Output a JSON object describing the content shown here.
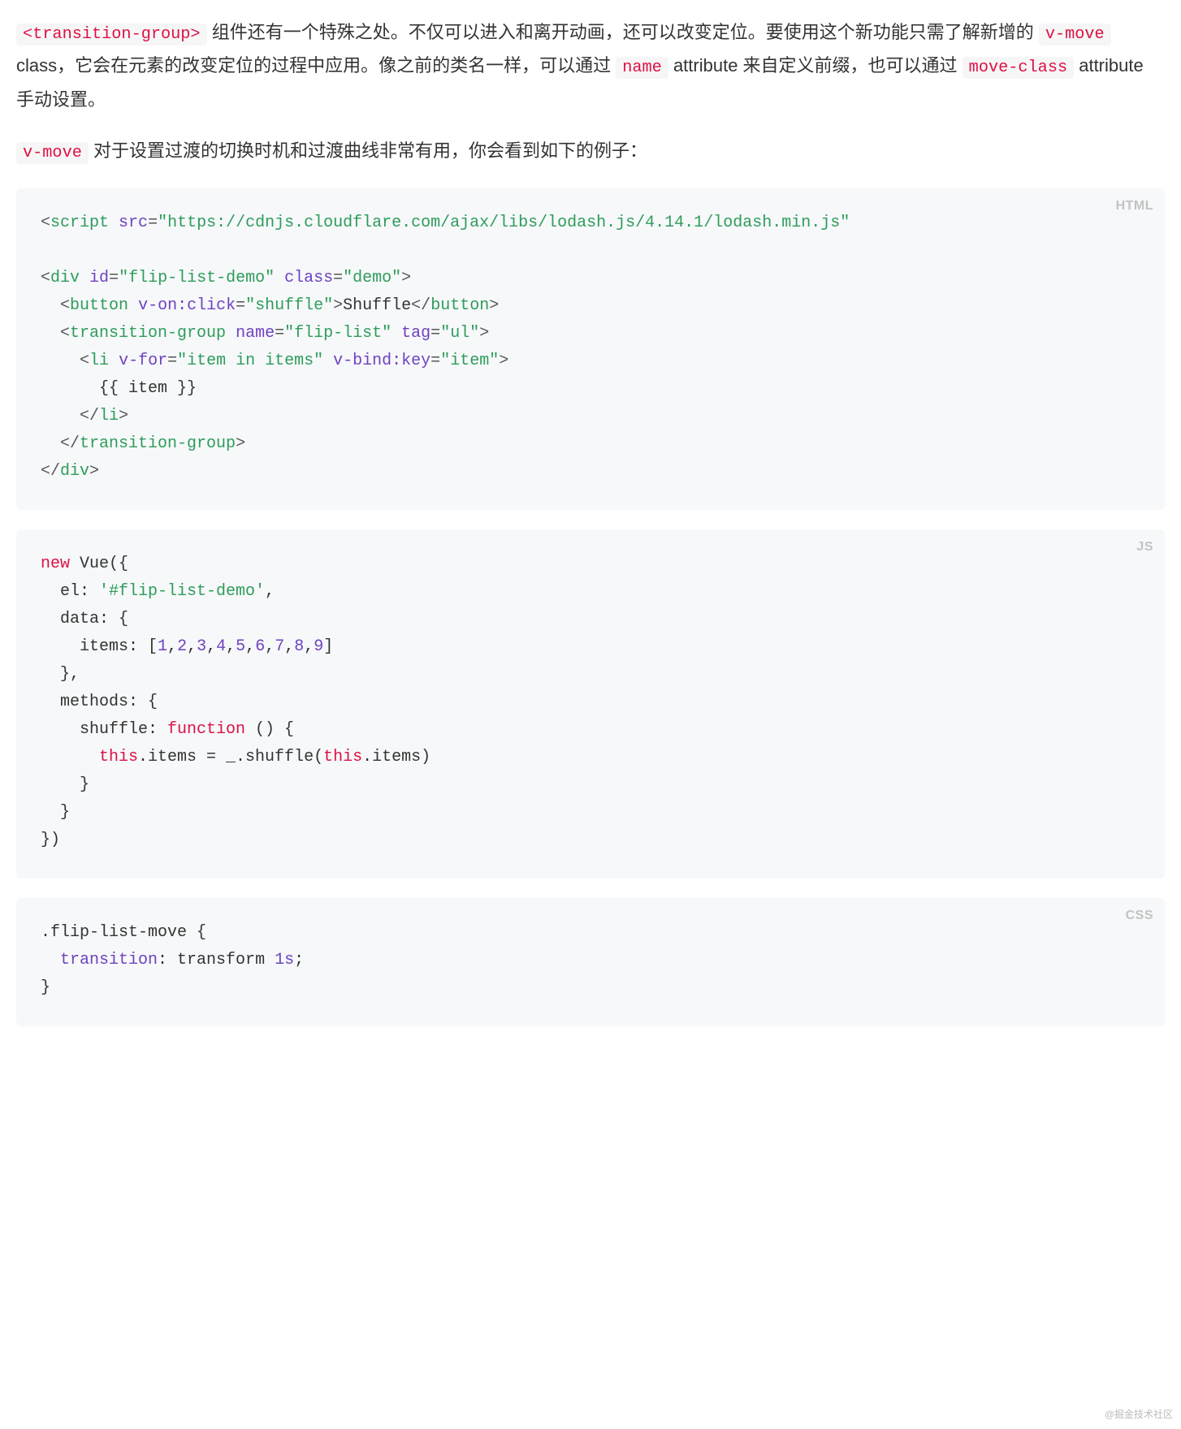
{
  "para1": {
    "seg1a": "<transition-group>",
    "seg1b": " 组件还有一个特殊之处。不仅可以进入和离开动画，还可以改变定位。要使用这个新功能只需了解新增的 ",
    "seg1c": "v-move",
    "seg1d": " class，它会在元素的改变定位的过程中应用。像之前的类名一样，可以通过 ",
    "seg1e": "name",
    "seg1f": " attribute 来自定义前缀，也可以通过 ",
    "seg1g": "move-class",
    "seg1h": " attribute 手动设置。"
  },
  "para2": {
    "seg2a": "v-move",
    "seg2b": " 对于设置过渡的切换时机和过渡曲线非常有用，你会看到如下的例子："
  },
  "codeHtml": {
    "label": "HTML",
    "l1_tag": "script",
    "l1_attr": "src",
    "l1_val": "\"https://cdnjs.cloudflare.com/ajax/libs/lodash.js/4.14.1/lodash.min.js\"",
    "l2_tag": "div",
    "l2_attr1": "id",
    "l2_val1": "\"flip-list-demo\"",
    "l2_attr2": "class",
    "l2_val2": "\"demo\"",
    "l3_tag": "button",
    "l3_attr": "v-on:click",
    "l3_val": "\"shuffle\"",
    "l3_text": "Shuffle",
    "l4_tag": "transition-group",
    "l4_attr1": "name",
    "l4_val1": "\"flip-list\"",
    "l4_attr2": "tag",
    "l4_val2": "\"ul\"",
    "l5_tag": "li",
    "l5_attr1": "v-for",
    "l5_val1": "\"item in items\"",
    "l5_attr2": "v-bind:key",
    "l5_val2": "\"item\"",
    "l6_text": "{{ item }}"
  },
  "codeJs": {
    "label": "JS",
    "kw_new": "new",
    "vue": " Vue({",
    "el_key": "  el: ",
    "el_val": "'#flip-list-demo'",
    "comma": ",",
    "data_open": "  data: {",
    "items_pre": "    items: [",
    "nums": [
      "1",
      "2",
      "3",
      "4",
      "5",
      "6",
      "7",
      "8",
      "9"
    ],
    "items_post": "]",
    "brace_close2": "  },",
    "methods_open": "  methods: {",
    "shuffle_pre": "    shuffle: ",
    "kw_function": "function",
    "shuffle_post": " () {",
    "body_pre": "      ",
    "kw_this1": "this",
    "body_mid1": ".items = _.shuffle(",
    "kw_this2": "this",
    "body_mid2": ".items)",
    "brace_inner": "    }",
    "brace_methods": "  }",
    "brace_end": "})"
  },
  "codeCss": {
    "label": "CSS",
    "selector": ".flip-list-move {",
    "prop": "  transition",
    "colon": ": ",
    "val": "transform ",
    "dur": "1s",
    "semi": ";",
    "close": "}"
  },
  "watermark": "@掘金技术社区"
}
